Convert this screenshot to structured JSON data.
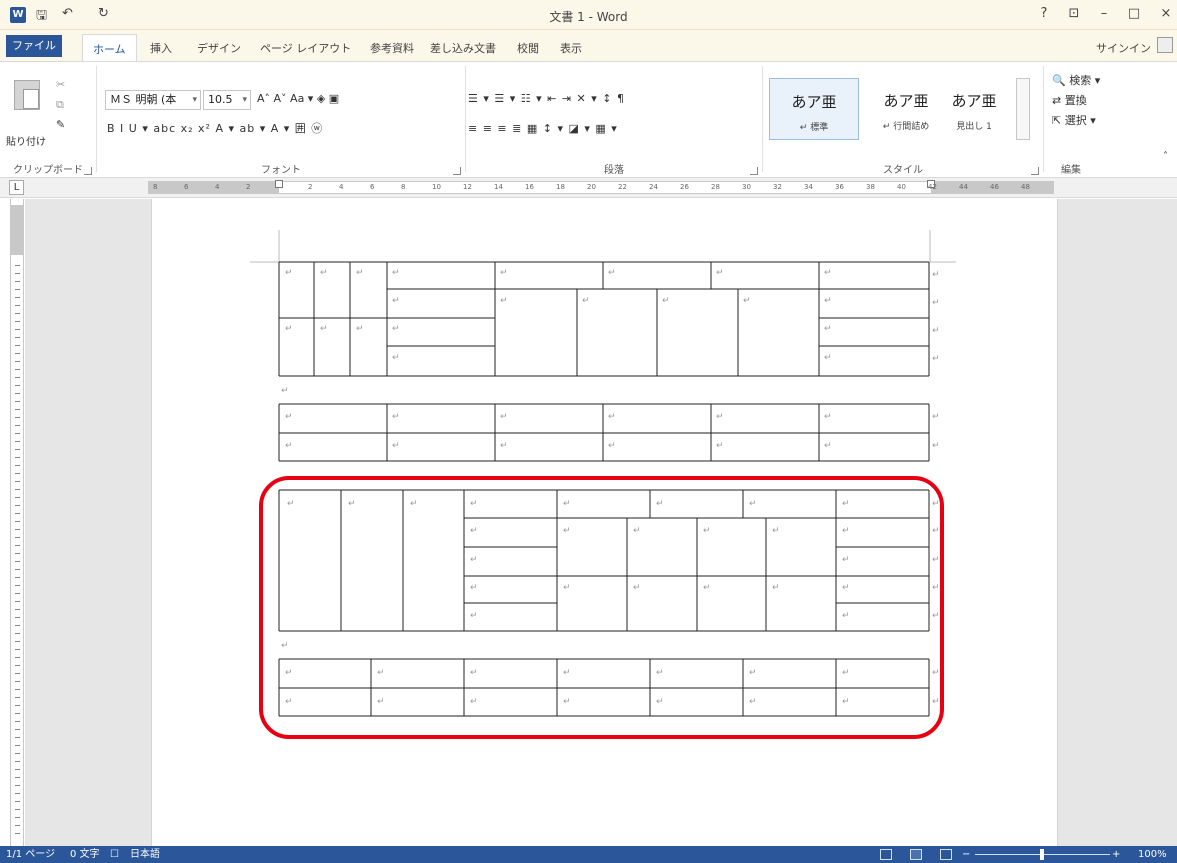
{
  "window": {
    "title": "文書 1 - Word",
    "app_icon": "W",
    "quick_access": [
      {
        "icon": "save-icon",
        "glyph": "🖫"
      },
      {
        "icon": "undo-icon",
        "glyph": "↶"
      },
      {
        "icon": "redo-icon",
        "glyph": "↻"
      }
    ],
    "controls": {
      "help": "?",
      "minimize": "–",
      "maximize": "□",
      "close": "×"
    }
  },
  "tabs": {
    "file": "ファイル",
    "items": [
      "ホーム",
      "挿入",
      "デザイン",
      "ページ レイアウト",
      "参考資料",
      "差し込み文書",
      "校閲",
      "表示"
    ],
    "active": "ホーム",
    "signin": "サインイン"
  },
  "ribbon": {
    "clipboard": {
      "paste": "貼り付け",
      "label": "クリップボード"
    },
    "font": {
      "name": "ＭＳ 明朝 (本",
      "size": "10.5",
      "row1": "A˄ A˅  Aa ▾   ◈  ▣",
      "row2": "B  I  U ▾  abc  x₂  x²   A ▾  ab ▾  A ▾  囲 ⓦ",
      "label": "フォント"
    },
    "paragraph": {
      "row1": "☰ ▾  ☰ ▾  ☷ ▾   ⇤  ⇥   ✕ ▾   ↕  ¶",
      "row2": "≡  ≡  ≡  ≣  ▦   ↕ ▾   ◪ ▾  ▦ ▾",
      "label": "段落"
    },
    "styles": {
      "items": [
        {
          "sample": "あア亜",
          "name": "↵ 標準"
        },
        {
          "sample": "あア亜",
          "name": "↵ 行間詰め"
        },
        {
          "sample": "あア亜",
          "name": "見出し 1"
        }
      ],
      "label": "スタイル"
    },
    "editing": {
      "find": "検索 ▾",
      "replace": "置換",
      "select": "選択 ▾",
      "label": "編集"
    }
  },
  "document": {
    "cell_mark": "↵",
    "para_mark": "↵"
  },
  "status": {
    "page": "1/1 ページ",
    "words": "0 文字",
    "proof_icon": "☐",
    "language": "日本語",
    "zoom": "100%"
  },
  "accent": {
    "brand": "#2b579a",
    "highlight": "#e60012"
  }
}
